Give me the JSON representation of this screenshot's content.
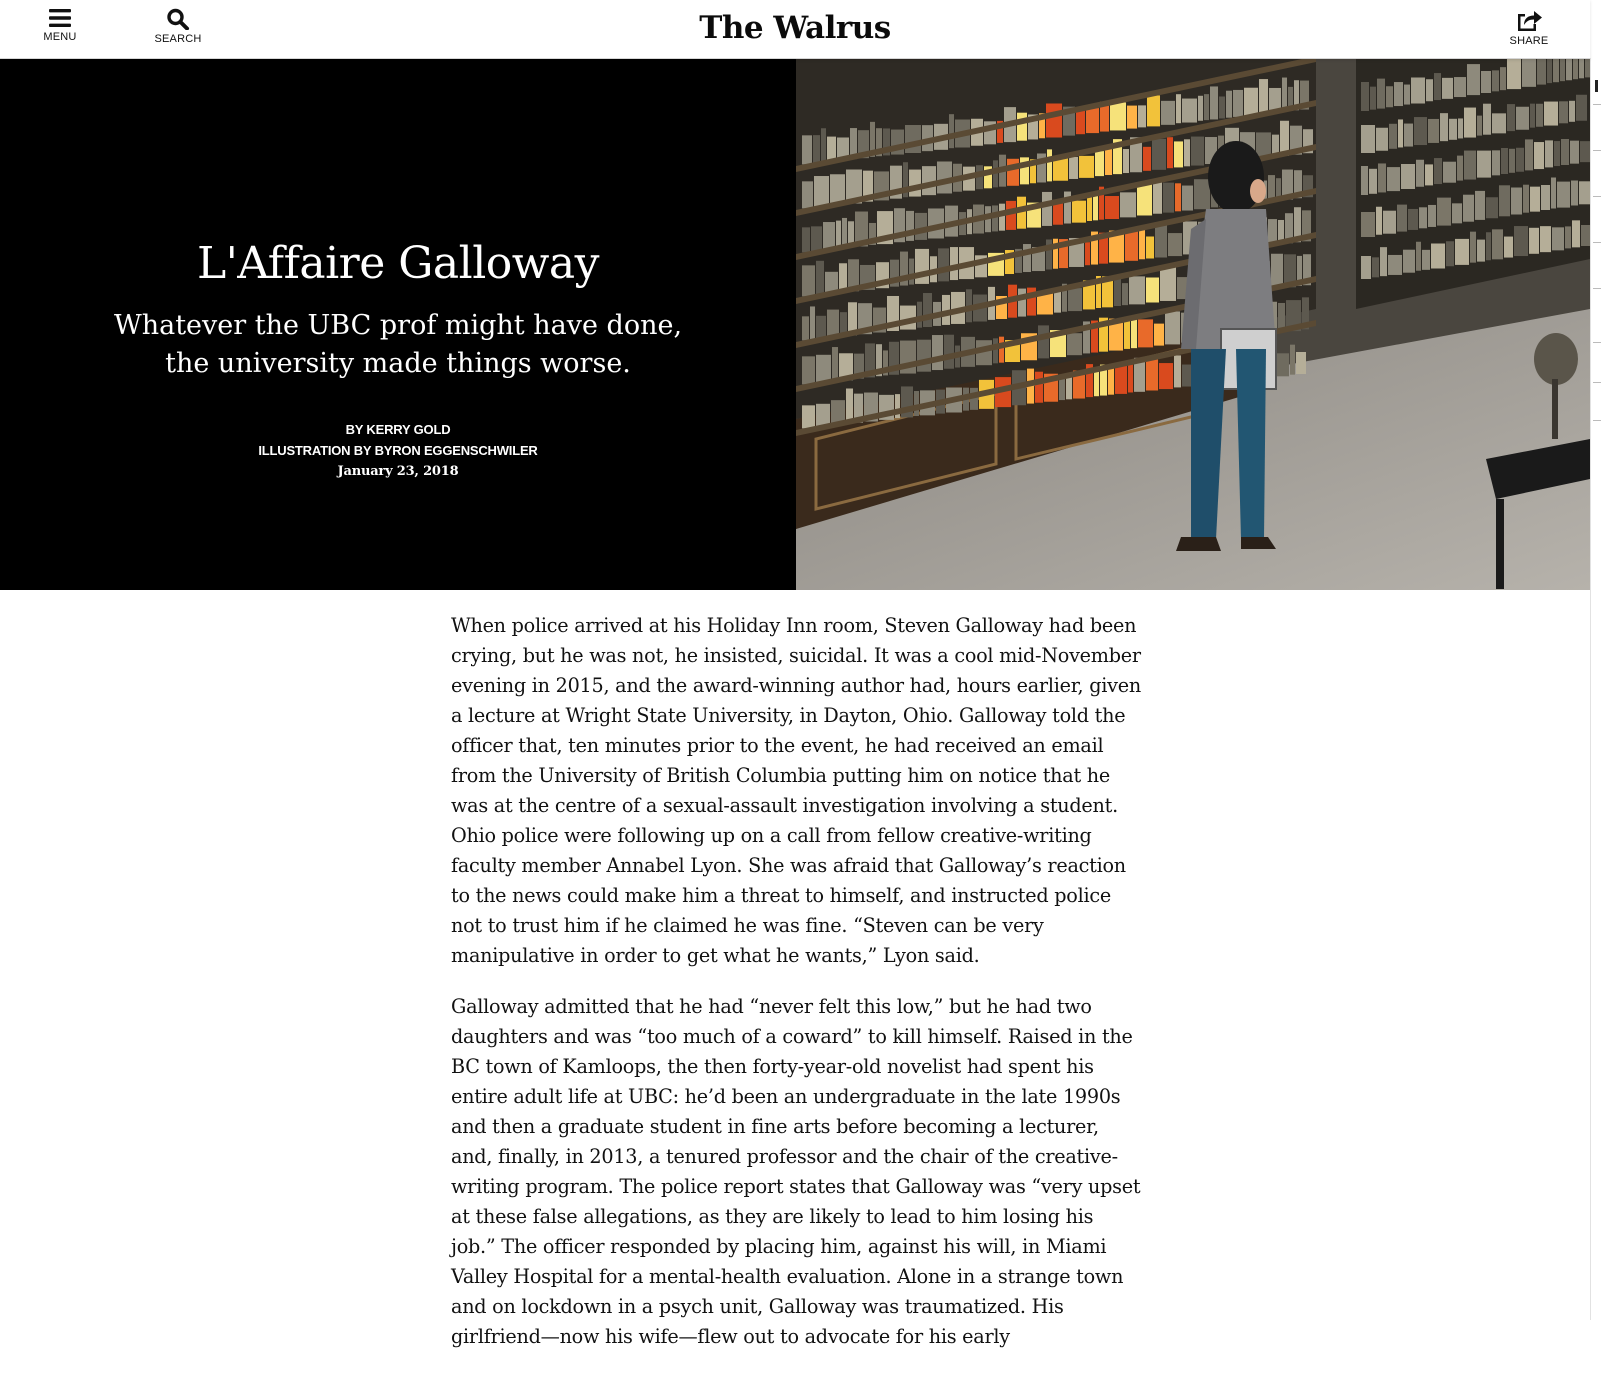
{
  "header": {
    "menu_label": "MENU",
    "search_label": "SEARCH",
    "logo": "The Walrus",
    "share_label": "SHARE"
  },
  "hero": {
    "title": "L'Affaire Galloway",
    "dek": "Whatever the UBC prof might have done, the university made things worse.",
    "byline": "BY KERRY GOLD",
    "illustration_credit": "ILLUSTRATION BY BYRON EGGENSCHWILER",
    "date": "January 23, 2018"
  },
  "article": {
    "paragraphs": [
      "When police arrived at his Holiday Inn room, Steven Galloway had been crying, but he was not, he insisted, suicidal. It was a cool mid-November evening in 2015, and the award-winning author had, hours earlier, given a lecture at Wright State University, in Dayton, Ohio. Galloway told the officer that, ten minutes prior to the event, he had received an email from the University of British Columbia putting him on notice that he was at the centre of a sexual-assault investigation involving a student. Ohio police were following up on a call from fellow creative-writing faculty member Annabel Lyon. She was afraid that Galloway’s reaction to the news could make him a threat to himself, and instructed police not to trust him if he claimed he was fine. “Steven can be very manipulative in order to get what he wants,” Lyon said.",
      "Galloway admitted that he had “never felt this low,” but he had two daughters and was “too much of a coward” to kill himself. Raised in the BC town of Kamloops, the then forty-year-old novelist had spent his entire adult life at UBC: he’d been an undergraduate in the late 1990s and then a graduate student in fine arts before becoming a lecturer, and, finally, in 2013, a tenured professor and the chair of the creative-writing program. The police report states that Galloway was “very upset at these false allegations, as they are likely to lead to him losing his job.” The officer responded by placing him, against his will, in Miami Valley Hospital for a mental-health evaluation. Alone in a strange town and on lockdown in a psych unit, Galloway was traumatized. His girlfriend—now his wife—flew out to advocate for his early"
    ]
  },
  "icons": {
    "menu": "hamburger-icon",
    "search": "magnifier-icon",
    "share": "share-arrow-icon"
  },
  "colors": {
    "hero_background": "#000000",
    "hero_text": "#ffffff",
    "body_text": "#111111"
  }
}
